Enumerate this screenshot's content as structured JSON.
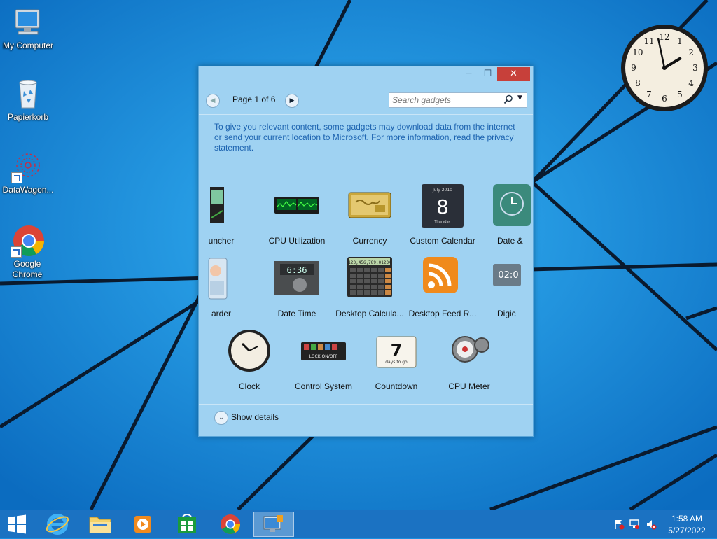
{
  "desktop": {
    "icons": [
      {
        "label": "My Computer"
      },
      {
        "label": "Papierkorb"
      },
      {
        "label": "DataWagon..."
      },
      {
        "label": "Google Chrome"
      }
    ]
  },
  "clock_gadget": {
    "hour": 1,
    "minute": 58,
    "numerals": [
      "12",
      "1",
      "2",
      "3",
      "4",
      "5",
      "6",
      "7",
      "8",
      "9",
      "10",
      "11"
    ]
  },
  "window": {
    "buttons": {
      "minimize": "─",
      "maximize": "☐",
      "close": "✕"
    },
    "pager": {
      "label": "Page 1 of 6",
      "prev_symbol": "◀",
      "next_symbol": "▶"
    },
    "search": {
      "placeholder": "Search gadgets",
      "dropdown_symbol": "▼"
    },
    "privacy_notice": "To give you relevant content, some gadgets may download data from the internet or send your current location to Microsoft. For more information, read the privacy statement.",
    "gadgets": [
      {
        "label": "uncher",
        "icon": "launcher-icon"
      },
      {
        "label": "CPU Utilization",
        "icon": "cpu-utilization-icon"
      },
      {
        "label": "Currency",
        "icon": "currency-icon"
      },
      {
        "label": "Custom Calendar",
        "icon": "calendar-icon",
        "calendar_month": "July 2010",
        "calendar_day": "8",
        "calendar_weekday": "Thursday"
      },
      {
        "label": "Date &",
        "icon": "date-clock-icon"
      },
      {
        "label": "arder",
        "icon": "guarder-icon"
      },
      {
        "label": "Date Time",
        "icon": "date-time-icon",
        "display_text": "6:36"
      },
      {
        "label": "Desktop Calcula...",
        "icon": "calculator-icon",
        "display_text": "123,456,789.01234"
      },
      {
        "label": "Desktop Feed R...",
        "icon": "rss-feed-icon"
      },
      {
        "label": "Digic",
        "icon": "digital-clock-icon",
        "display_text": "02:0"
      },
      {
        "label": "Clock",
        "icon": "clock-icon"
      },
      {
        "label": "Control System",
        "icon": "control-system-icon",
        "display_text": "LOCK ON/OFF"
      },
      {
        "label": "Countdown",
        "icon": "countdown-icon",
        "display_text": "7",
        "sub_text": "days to go"
      },
      {
        "label": "CPU Meter",
        "icon": "cpu-meter-icon"
      }
    ],
    "show_details": {
      "label": "Show details",
      "symbol": "⌄"
    }
  },
  "taskbar": {
    "items": [
      {
        "name": "start",
        "icon": "windows-logo-icon"
      },
      {
        "name": "internet-explorer",
        "icon": "internet-explorer-icon"
      },
      {
        "name": "file-explorer",
        "icon": "folder-icon"
      },
      {
        "name": "media-player",
        "icon": "media-player-icon"
      },
      {
        "name": "store",
        "icon": "store-icon"
      },
      {
        "name": "chrome",
        "icon": "chrome-icon"
      },
      {
        "name": "gadgets",
        "icon": "gadgets-icon",
        "active": true
      }
    ],
    "tray_icons": [
      "action-center-flag-icon",
      "network-icon",
      "volume-muted-icon"
    ],
    "time": "1:58 AM",
    "date": "5/27/2022"
  },
  "colors": {
    "wallpaper": "#1a8fe0",
    "taskbar": "#1b72c2",
    "window": "#9fd2f2",
    "close": "#c7403a",
    "link_text": "#1c63b0"
  }
}
